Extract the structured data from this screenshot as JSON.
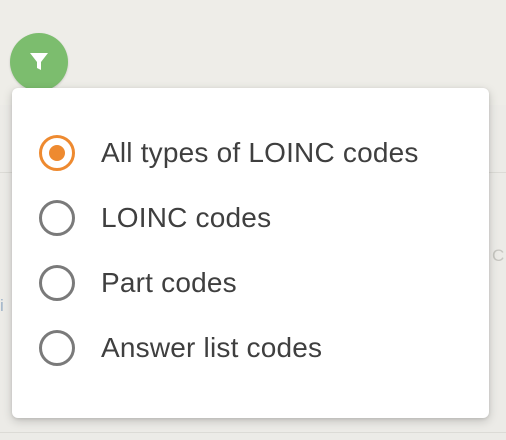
{
  "filter": {
    "button_icon": "filter-icon",
    "button_color": "#7cbd6e",
    "accent_color": "#ee8a30",
    "options": [
      {
        "label": "All types of LOINC codes",
        "selected": true
      },
      {
        "label": "LOINC codes",
        "selected": false
      },
      {
        "label": "Part codes",
        "selected": false
      },
      {
        "label": "Answer list codes",
        "selected": false
      }
    ]
  },
  "background": {
    "peek_right": "C",
    "peek_left": "i"
  }
}
